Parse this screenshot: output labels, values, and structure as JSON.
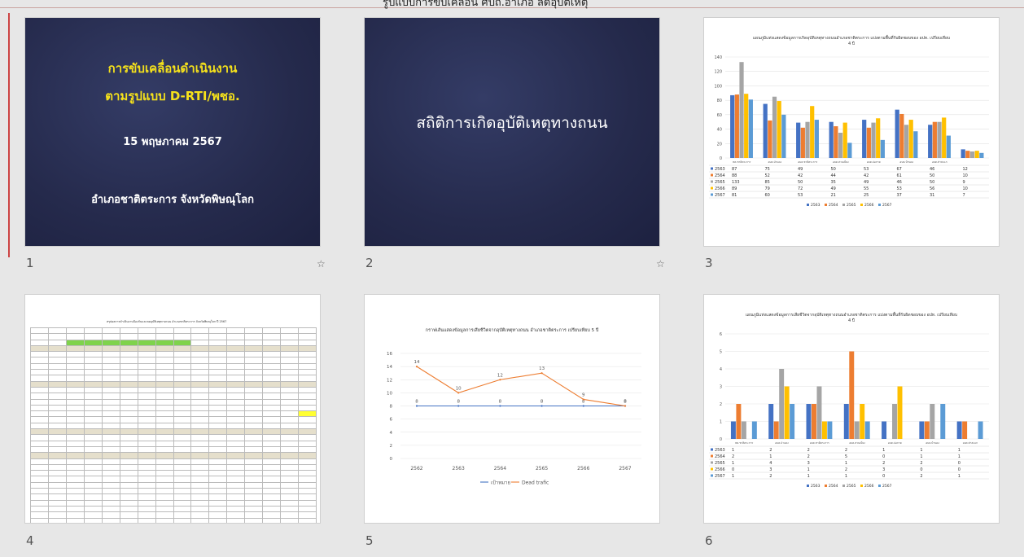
{
  "header": {
    "title": "รูปแบบการขับเคลื่อน ศปถ.อำเภอ ลดอุบัติเหตุ"
  },
  "slides": [
    {
      "number": "1",
      "lines": [
        "การขับเคลื่อนดำเนินงาน",
        "ตามรูปแบบ D-RTI/พชอ.",
        "15 พฤษภาคม 2567",
        "อำเภอชาติตระการ จังหวัดพิษณุโลก"
      ],
      "has_transition": true
    },
    {
      "number": "2",
      "title": "สถิติการเกิดอุบัติเหตุทางถนน",
      "has_transition": true
    },
    {
      "number": "3",
      "title": "แผนภูมิแท่งแสดงข้อมูลการเกิดอุบัติเหตุทางถนนอำเภอชาติตระการ แบ่งตามพื้นที่รับผิดชอบของ อปท. เปรียบเทียบ 4 ปี"
    },
    {
      "number": "4",
      "title": "สรุปผลการดำเนินงานป้องกันและลดอุบัติเหตุทางถนน อำเภอชาติตระการ จังหวัดพิษณุโลก ปี 2567"
    },
    {
      "number": "5",
      "title": "กราฟเส้นแสดงข้อมูลการเสียชีวิตจากอุบัติเหตุทางถนน อำเภอชาติตระการ เปรียบเทียบ 5 ปี"
    },
    {
      "number": "6",
      "title": "แผนภูมิแท่งแสดงข้อมูลการเสียชีวิตจากอุบัติเหตุทางถนนอำเภอชาติตระการ แบ่งตามพื้นที่รับผิดชอบของ อปท. เปรียบเทียบ 4 ปี"
    }
  ],
  "icons": {
    "transition": "star-transition-icon"
  },
  "chart_data": [
    {
      "type": "bar",
      "slide": 3,
      "title": "แผนภูมิแท่งแสดงข้อมูลการเกิดอุบัติเหตุทางถนนอำเภอชาติตระการ แบ่งตามพื้นที่รับผิดชอบของ อปท. เปรียบเทียบ 4 ปี",
      "categories": [
        "ทต.ชาติตระการ",
        "อบต.ป่าแดง",
        "อบต.ชาติตระการ",
        "อบต.สวนเมี่ยง",
        "อบต.บ่อภาค",
        "อบต.บ้านดง",
        "อบต.ท่าสะแก"
      ],
      "ylim": [
        0,
        140
      ],
      "series": [
        {
          "name": "2563",
          "color": "#4472c4",
          "values": [
            87,
            75,
            49,
            50,
            53,
            67,
            46
          ]
        },
        {
          "name": "2564",
          "color": "#ed7d31",
          "values": [
            88,
            52,
            42,
            44,
            42,
            61,
            50
          ]
        },
        {
          "name": "2565",
          "color": "#a5a5a5",
          "values": [
            133,
            85,
            50,
            35,
            49,
            46,
            50
          ]
        },
        {
          "name": "2566",
          "color": "#ffc000",
          "values": [
            89,
            79,
            72,
            49,
            55,
            53,
            56
          ]
        },
        {
          "name": "2567",
          "color": "#5b9bd5",
          "values": [
            81,
            60,
            53,
            21,
            25,
            37,
            31
          ]
        }
      ],
      "extra_category": {
        "values": [
          12,
          10,
          9,
          10,
          7
        ]
      }
    },
    {
      "type": "line",
      "slide": 5,
      "title": "กราฟเส้นแสดงข้อมูลการเสียชีวิตจากอุบัติเหตุทางถนน อำเภอชาติตระการ เปรียบเทียบ 5 ปี",
      "x": [
        "2562",
        "2563",
        "2564",
        "2565",
        "2566",
        "2567"
      ],
      "ylim": [
        0,
        16
      ],
      "series": [
        {
          "name": "เป้าหมาย",
          "color": "#4472c4",
          "values": [
            8,
            8,
            8,
            8,
            8,
            8
          ]
        },
        {
          "name": "Dead trafic",
          "color": "#ed7d31",
          "values": [
            14,
            10,
            12,
            13,
            9,
            8
          ]
        }
      ]
    },
    {
      "type": "bar",
      "slide": 6,
      "title": "แผนภูมิแท่งแสดงข้อมูลการเสียชีวิตจากอุบัติเหตุทางถนนอำเภอชาติตระการ แบ่งตามพื้นที่รับผิดชอบของ อปท. เปรียบเทียบ 4 ปี",
      "categories": [
        "ทต.ชาติตระการ",
        "อบต.ป่าแดง",
        "อบต.ชาติตระการ",
        "อบต.สวนเมี่ยง",
        "อบต.บ่อภาค",
        "อบต.บ้านดง",
        "อบต.ท่าสะแก"
      ],
      "ylim": [
        0,
        6
      ],
      "series": [
        {
          "name": "2563",
          "color": "#4472c4",
          "values": [
            1,
            2,
            2,
            2,
            1,
            1,
            1
          ]
        },
        {
          "name": "2564",
          "color": "#ed7d31",
          "values": [
            2,
            1,
            2,
            5,
            0,
            1,
            1
          ]
        },
        {
          "name": "2565",
          "color": "#a5a5a5",
          "values": [
            1,
            4,
            3,
            1,
            2,
            2,
            0
          ]
        },
        {
          "name": "2566",
          "color": "#ffc000",
          "values": [
            0,
            3,
            1,
            2,
            3,
            0,
            0
          ]
        },
        {
          "name": "2567",
          "color": "#5b9bd5",
          "values": [
            1,
            2,
            1,
            1,
            0,
            2,
            1
          ]
        }
      ]
    }
  ]
}
